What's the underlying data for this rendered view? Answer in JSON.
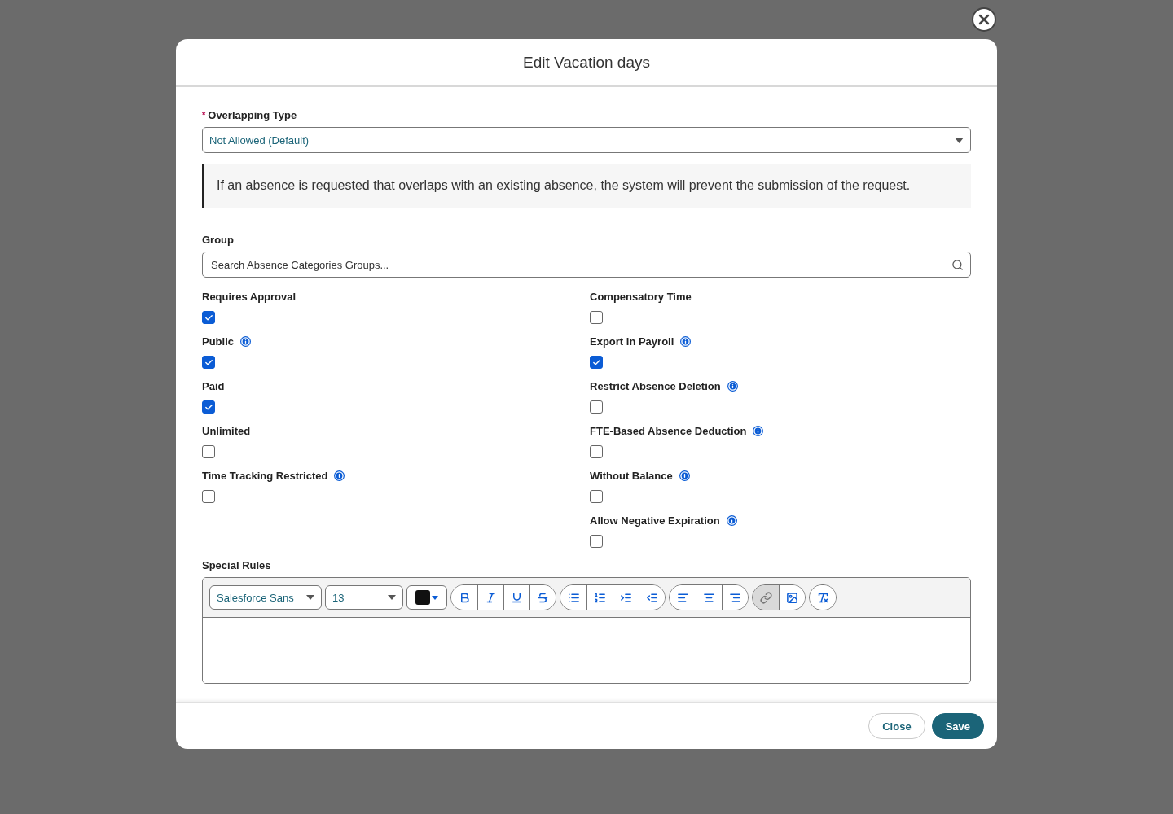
{
  "modal": {
    "title": "Edit Vacation days"
  },
  "overlapping": {
    "label": "Overlapping Type",
    "required_mark": "*",
    "value": "Not Allowed (Default)",
    "note": "If an absence is requested that overlaps with an existing absence, the system will prevent the submission of the request."
  },
  "group": {
    "label": "Group",
    "placeholder": "Search Absence Categories Groups..."
  },
  "columns": [
    [
      {
        "label": "Requires Approval",
        "info": false,
        "checked": true
      },
      {
        "label": "Public",
        "info": true,
        "checked": true
      },
      {
        "label": "Paid",
        "info": false,
        "checked": true
      },
      {
        "label": "Unlimited",
        "info": false,
        "checked": false
      },
      {
        "label": "Time Tracking Restricted",
        "info": true,
        "checked": false
      }
    ],
    [
      {
        "label": "Compensatory Time",
        "info": false,
        "checked": false
      },
      {
        "label": "Export in Payroll",
        "info": true,
        "checked": true
      },
      {
        "label": "Restrict Absence Deletion",
        "info": true,
        "checked": false
      },
      {
        "label": "FTE-Based Absence Deduction",
        "info": true,
        "checked": false
      },
      {
        "label": "Without Balance",
        "info": true,
        "checked": false
      },
      {
        "label": "Allow Negative Expiration",
        "info": true,
        "checked": false
      }
    ]
  ],
  "special_rules": {
    "label": "Special Rules",
    "font": "Salesforce Sans",
    "size": "13",
    "groups": [
      [
        {
          "kind": "bold",
          "pressed": false
        },
        {
          "kind": "italic",
          "pressed": false
        },
        {
          "kind": "underline",
          "pressed": false
        },
        {
          "kind": "strike",
          "pressed": false
        }
      ],
      [
        {
          "kind": "bullets",
          "pressed": false
        },
        {
          "kind": "numbers",
          "pressed": false
        },
        {
          "kind": "indent",
          "pressed": false
        },
        {
          "kind": "outdent",
          "pressed": false
        }
      ],
      [
        {
          "kind": "align-left",
          "pressed": false
        },
        {
          "kind": "align-center",
          "pressed": false
        },
        {
          "kind": "align-right",
          "pressed": false
        }
      ],
      [
        {
          "kind": "link",
          "pressed": true
        },
        {
          "kind": "image",
          "pressed": false
        }
      ],
      [
        {
          "kind": "clear",
          "pressed": false
        }
      ]
    ]
  },
  "footer": {
    "buttons": [
      {
        "label": "Close",
        "kind": "neutral"
      },
      {
        "label": "Save",
        "kind": "brand"
      }
    ]
  }
}
